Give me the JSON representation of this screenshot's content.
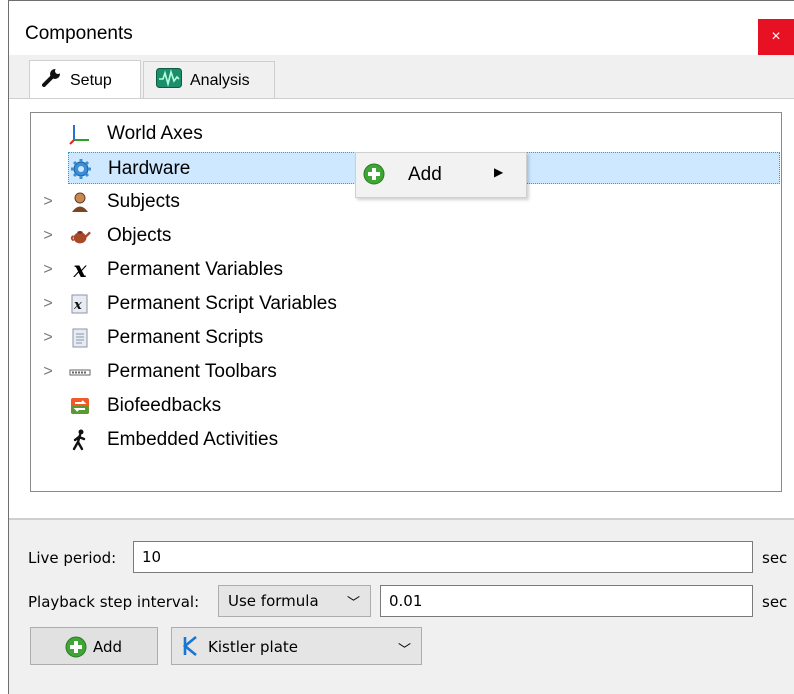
{
  "window": {
    "title": "Components",
    "close_glyph": "×"
  },
  "tabs": [
    {
      "label": "Setup",
      "icon": "wrench-icon",
      "active": true
    },
    {
      "label": "Analysis",
      "icon": "waveform-icon",
      "active": false
    }
  ],
  "tree": {
    "items": [
      {
        "label": "World Axes",
        "icon": "axes-icon",
        "expandable": false,
        "selected": false
      },
      {
        "label": "Hardware",
        "icon": "gear-icon",
        "expandable": false,
        "selected": true
      },
      {
        "label": "Subjects",
        "icon": "person-icon",
        "expandable": true,
        "selected": false
      },
      {
        "label": "Objects",
        "icon": "teapot-icon",
        "expandable": true,
        "selected": false
      },
      {
        "label": "Permanent Variables",
        "icon": "variable-x-icon",
        "expandable": true,
        "selected": false
      },
      {
        "label": "Permanent Script Variables",
        "icon": "script-variable-icon",
        "expandable": true,
        "selected": false
      },
      {
        "label": "Permanent Scripts",
        "icon": "script-icon",
        "expandable": true,
        "selected": false
      },
      {
        "label": "Permanent Toolbars",
        "icon": "toolbar-icon",
        "expandable": true,
        "selected": false
      },
      {
        "label": "Biofeedbacks",
        "icon": "biofeedback-icon",
        "expandable": false,
        "selected": false
      },
      {
        "label": "Embedded Activities",
        "icon": "walking-person-icon",
        "expandable": false,
        "selected": false
      }
    ]
  },
  "context_menu": {
    "items": [
      {
        "label": "Add",
        "icon": "plus-circle-icon",
        "has_submenu": true
      }
    ]
  },
  "settings": {
    "live_period_label": "Live period:",
    "live_period_value": "10",
    "live_period_unit": "sec",
    "playback_label": "Playback step interval:",
    "playback_mode": "Use formula",
    "playback_value": "0.01",
    "playback_unit": "sec"
  },
  "toolbar": {
    "add_label": "Add",
    "device_selected": "Kistler plate"
  },
  "colors": {
    "accent": "#26a0da",
    "selection": "#cde8ff",
    "close": "#e81123",
    "add_green": "#3fa535"
  }
}
